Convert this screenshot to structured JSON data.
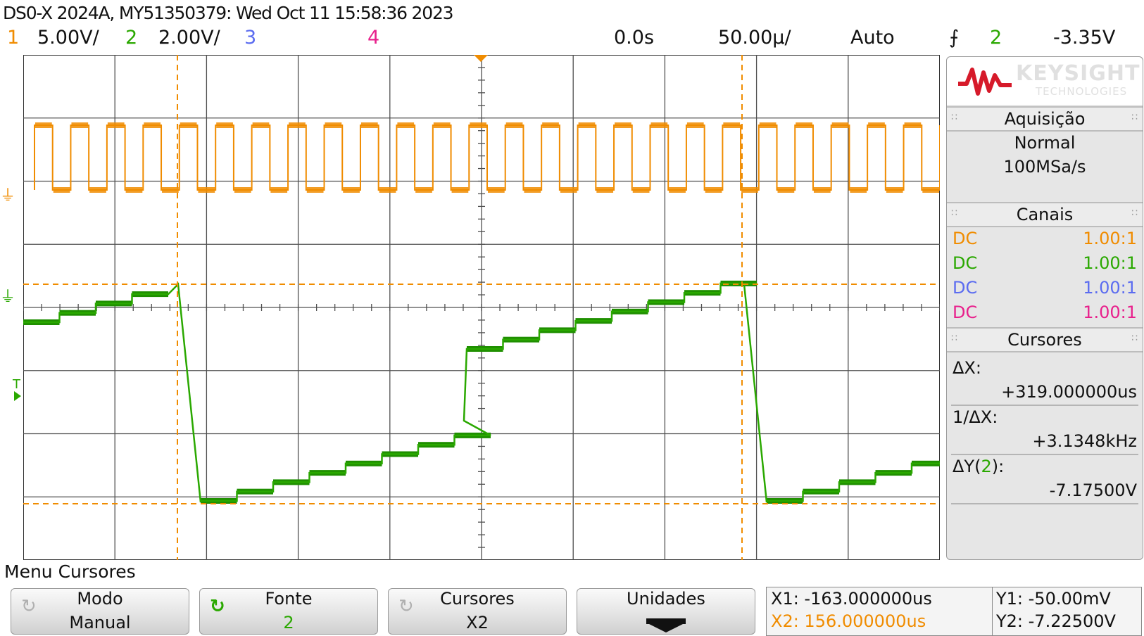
{
  "title": "DS0-X 2024A, MY51350379: Wed Oct 11 15:58:36 2023",
  "top_bar": {
    "ch1_num": "1",
    "ch1_scale": "5.00V/",
    "ch2_num": "2",
    "ch2_scale": "2.00V/",
    "ch3_num": "3",
    "ch4_num": "4",
    "time_ref": "0.0s",
    "timebase": "50.00µ/",
    "trigger_mode": "Auto",
    "trigger_symbol": "⨍",
    "trigger_source": "2",
    "trigger_level": "-3.35V"
  },
  "markers": {
    "ch1_label": "1",
    "ch2_label": "2",
    "trigger_label": "T"
  },
  "sidebar": {
    "brand": "KEYSIGHT",
    "brand_sub": "TECHNOLOGIES",
    "acq_title": "Aquisição",
    "acq_mode": "Normal",
    "acq_rate": "100MSa/s",
    "channels_title": "Canais",
    "channels": [
      {
        "coupling": "DC",
        "probe": "1.00:1"
      },
      {
        "coupling": "DC",
        "probe": "1.00:1"
      },
      {
        "coupling": "DC",
        "probe": "1.00:1"
      },
      {
        "coupling": "DC",
        "probe": "1.00:1"
      }
    ],
    "cursors_title": "Cursores",
    "dx_label": "ΔX:",
    "dx_value": "+319.000000us",
    "inv_dx_label": "1/ΔX:",
    "inv_dx_value": "+3.1348kHz",
    "dy_label_a": "ΔY(",
    "dy_label_ch": "2",
    "dy_label_b": "):",
    "dy_value": "-7.17500V"
  },
  "menu": {
    "title": "Menu Cursores",
    "softkeys": [
      {
        "line1": "Modo",
        "line2": "Manual"
      },
      {
        "line1": "Fonte",
        "line2": "2"
      },
      {
        "line1": "Cursores",
        "line2": "X2"
      },
      {
        "line1": "Unidades",
        "line2": ""
      }
    ]
  },
  "readout": {
    "x1": "X1: -163.000000us",
    "x2": "X2: 156.000000us",
    "y1": "Y1: -50.00mV",
    "y2": "Y2: -7.22500V"
  },
  "colors": {
    "ch1": "#f08c00",
    "ch2": "#2aa800",
    "ch3": "#5b6cf0",
    "ch4": "#e8208c",
    "grid": "#505050",
    "cursor": "#f08c00",
    "bg": "#ffffff"
  },
  "waveforms": {
    "ch1": {
      "shape": "square",
      "cycles": 25
    },
    "ch2": {
      "shape": "staircase",
      "steps": 8,
      "periods": 2
    }
  }
}
